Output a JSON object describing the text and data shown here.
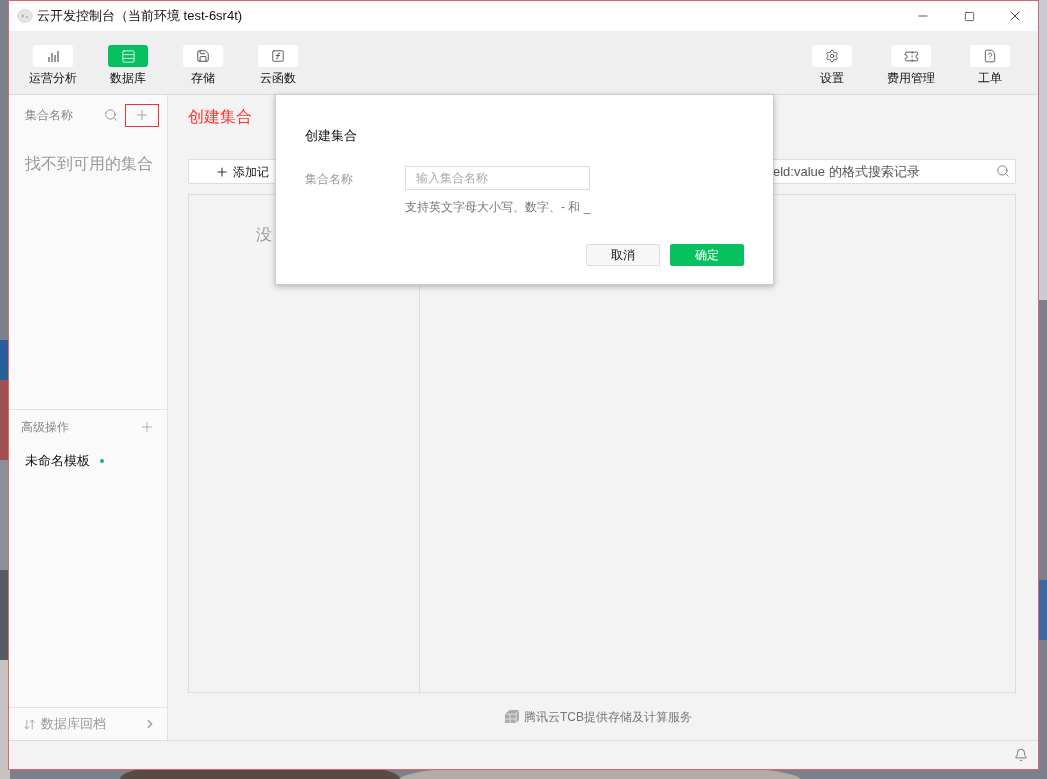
{
  "window": {
    "title": "云开发控制台（当前环境 test-6sr4t)"
  },
  "toolbar": {
    "left": [
      {
        "label": "运营分析",
        "kind": "chart",
        "selected": false
      },
      {
        "label": "数据库",
        "kind": "table",
        "selected": true
      },
      {
        "label": "存储",
        "kind": "storage",
        "selected": false
      },
      {
        "label": "云函数",
        "kind": "function",
        "selected": false
      }
    ],
    "right": [
      {
        "label": "设置",
        "kind": "settings"
      },
      {
        "label": "费用管理",
        "kind": "billing"
      },
      {
        "label": "工单",
        "kind": "ticket"
      }
    ]
  },
  "sidebar": {
    "header": "集合名称",
    "empty_text": "找不到可用的集合",
    "advanced_title": "高级操作",
    "templates": [
      {
        "label": "未命名模板",
        "color": "#07c160"
      }
    ],
    "rollback": "数据库回档"
  },
  "main": {
    "title": "创建集合",
    "add_button": "添加记",
    "empty_text": "没",
    "search_placeholder": "eld:value 的格式搜索记录",
    "footer": "腾讯云TCB提供存储及计算服务"
  },
  "dialog": {
    "title": "创建集合",
    "field_label": "集合名称",
    "placeholder": "输入集合名称",
    "hint": "支持英文字母大小写、数字、- 和 _",
    "buttons": [
      {
        "label": "取消",
        "kind": "secondary"
      },
      {
        "label": "确定",
        "kind": "primary"
      }
    ]
  }
}
